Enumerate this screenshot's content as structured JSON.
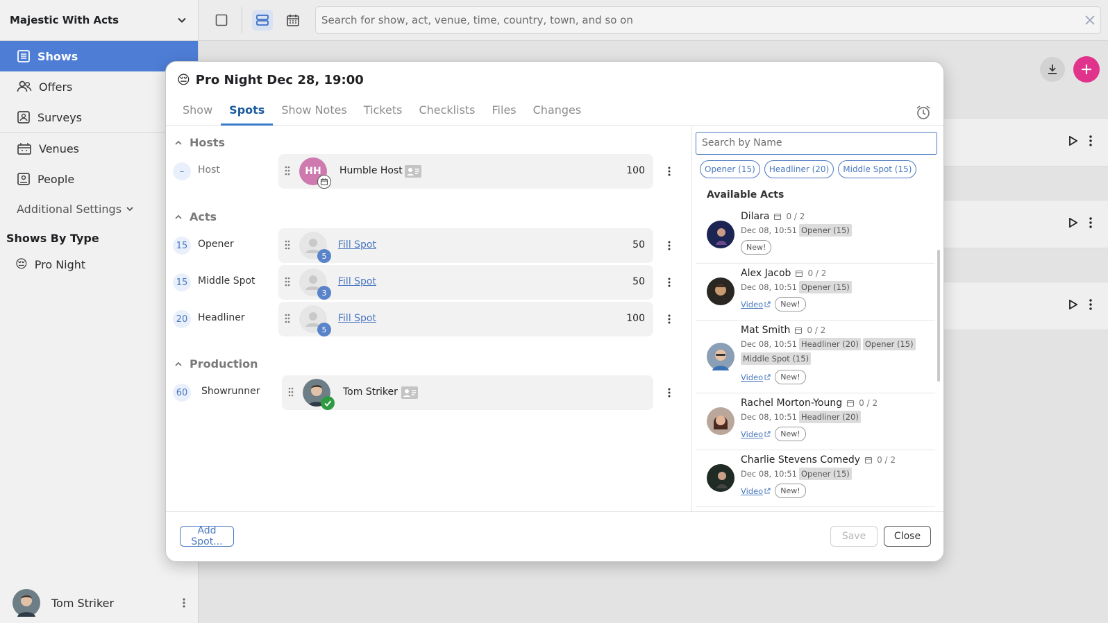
{
  "app": {
    "org_name": "Majestic With Acts",
    "nav": [
      {
        "label": "Shows"
      },
      {
        "label": "Offers"
      },
      {
        "label": "Surveys"
      },
      {
        "label": "Venues"
      },
      {
        "label": "People"
      }
    ],
    "additional_settings": "Additional Settings",
    "shows_by_type_heading": "Shows By Type",
    "show_types": [
      {
        "label": "Pro Night",
        "emoji": "😔"
      }
    ],
    "user_name": "Tom Striker",
    "search_placeholder": "Search for show, act, venue, time, country, town, and so on"
  },
  "modal": {
    "emoji": "😔",
    "title": "Pro Night Dec 28, 19:00",
    "tabs": [
      "Show",
      "Spots",
      "Show Notes",
      "Tickets",
      "Checklists",
      "Files",
      "Changes"
    ],
    "active_tab": "Spots",
    "groups": {
      "hosts": "Hosts",
      "acts": "Acts",
      "production": "Production"
    },
    "host_row": {
      "badge": "–",
      "label": "Host",
      "initials": "HH",
      "name": "Humble Host",
      "amount": "100"
    },
    "act_rows": [
      {
        "badge": "15",
        "label": "Opener",
        "count": "5",
        "link": "Fill Spot",
        "amount": "50"
      },
      {
        "badge": "15",
        "label": "Middle Spot",
        "count": "3",
        "link": "Fill Spot",
        "amount": "50"
      },
      {
        "badge": "20",
        "label": "Headliner",
        "count": "5",
        "link": "Fill Spot",
        "amount": "100"
      }
    ],
    "production_row": {
      "badge": "60",
      "label": "Showrunner",
      "name": "Tom Striker"
    },
    "name_search_placeholder": "Search by Name",
    "filter_chips": [
      "Opener (15)",
      "Headliner (20)",
      "Middle Spot (15)"
    ],
    "available_heading": "Available Acts",
    "available_acts": [
      {
        "name": "Dilara",
        "count": "0 / 2",
        "date": "Dec 08, 10:51",
        "tags": [
          "Opener (15)"
        ],
        "video": "",
        "new": "New!"
      },
      {
        "name": "Alex Jacob",
        "count": "0 / 2",
        "date": "Dec 08, 10:51",
        "tags": [
          "Opener (15)"
        ],
        "video": "Video",
        "new": "New!"
      },
      {
        "name": "Mat Smith",
        "count": "0 / 2",
        "date": "Dec 08, 10:51",
        "tags": [
          "Headliner (20)",
          "Opener (15)",
          "Middle Spot (15)"
        ],
        "video": "Video",
        "new": "New!"
      },
      {
        "name": "Rachel Morton-Young",
        "count": "0 / 2",
        "date": "Dec 08, 10:51",
        "tags": [
          "Headliner (20)"
        ],
        "video": "Video",
        "new": "New!"
      },
      {
        "name": "Charlie Stevens Comedy",
        "count": "0 / 2",
        "date": "Dec 08, 10:51",
        "tags": [
          "Opener (15)"
        ],
        "video": "Video",
        "new": "New!"
      }
    ],
    "buttons": {
      "add_spot": "Add Spot...",
      "save": "Save",
      "close": "Close"
    }
  },
  "colors": {
    "primary": "#4e7dd6",
    "accent": "#e0338c",
    "link": "#4a78c0"
  }
}
